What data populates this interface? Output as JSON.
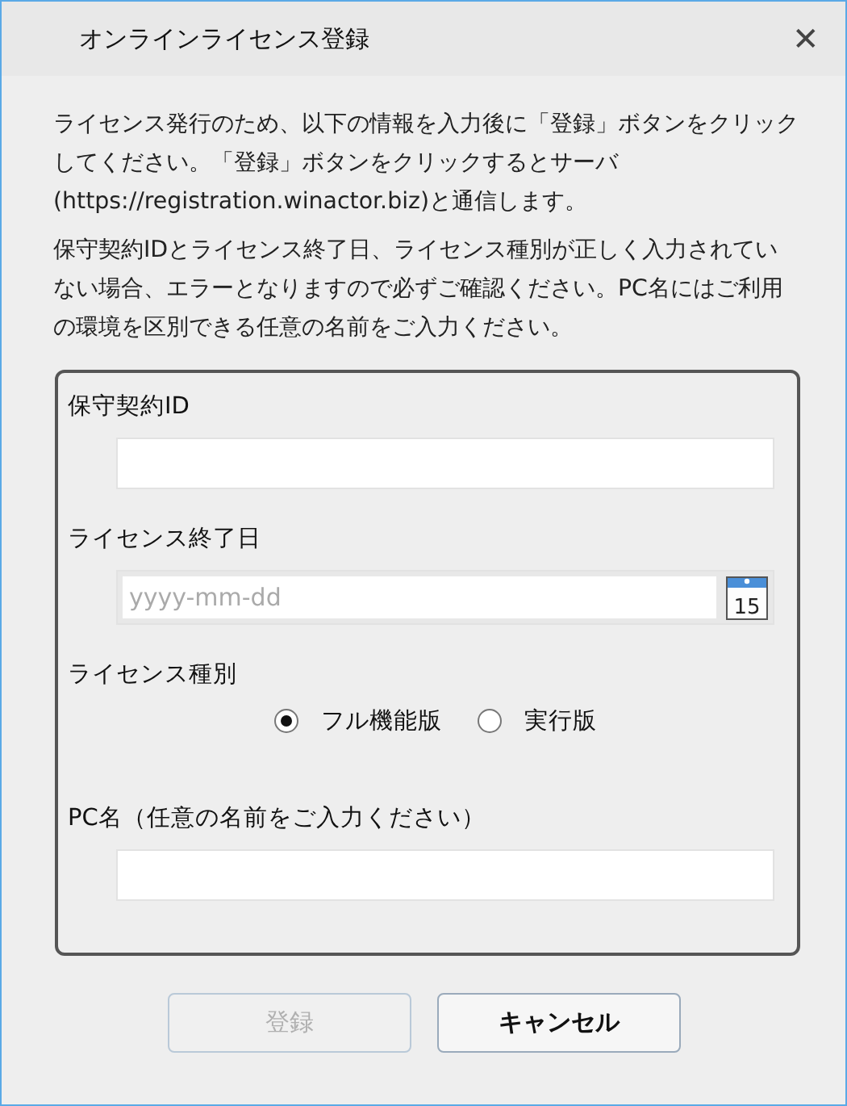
{
  "window": {
    "title": "オンラインライセンス登録",
    "close": "✕"
  },
  "intro": [
    "ライセンス発行のため、以下の情報を入力後に「登録」ボタンをクリックしてください。「登録」ボタンをクリックするとサーバ(https://registration.winactor.biz)と通信します。",
    "保守契約IDとライセンス終了日、ライセンス種別が正しく入力されていない場合、エラーとなりますので必ずご確認ください。PC名にはご利用の環境を区別できる任意の名前をご入力ください。"
  ],
  "form": [
    {
      "kind": "text",
      "label": "保守契約ID"
    },
    {
      "kind": "date",
      "label": "ライセンス終了日",
      "placeholder": "yyyy-mm-dd",
      "calendar_day": "15"
    },
    {
      "kind": "radio",
      "label": "ライセンス種別",
      "options": [
        {
          "label": "フル機能版",
          "selected": true
        },
        {
          "label": "実行版",
          "selected": false
        }
      ]
    },
    {
      "kind": "text",
      "label": "PC名（任意の名前をご入力ください）"
    }
  ],
  "buttons": [
    {
      "label": "登録",
      "disabled": true
    },
    {
      "label": "キャンセル",
      "disabled": false
    }
  ]
}
